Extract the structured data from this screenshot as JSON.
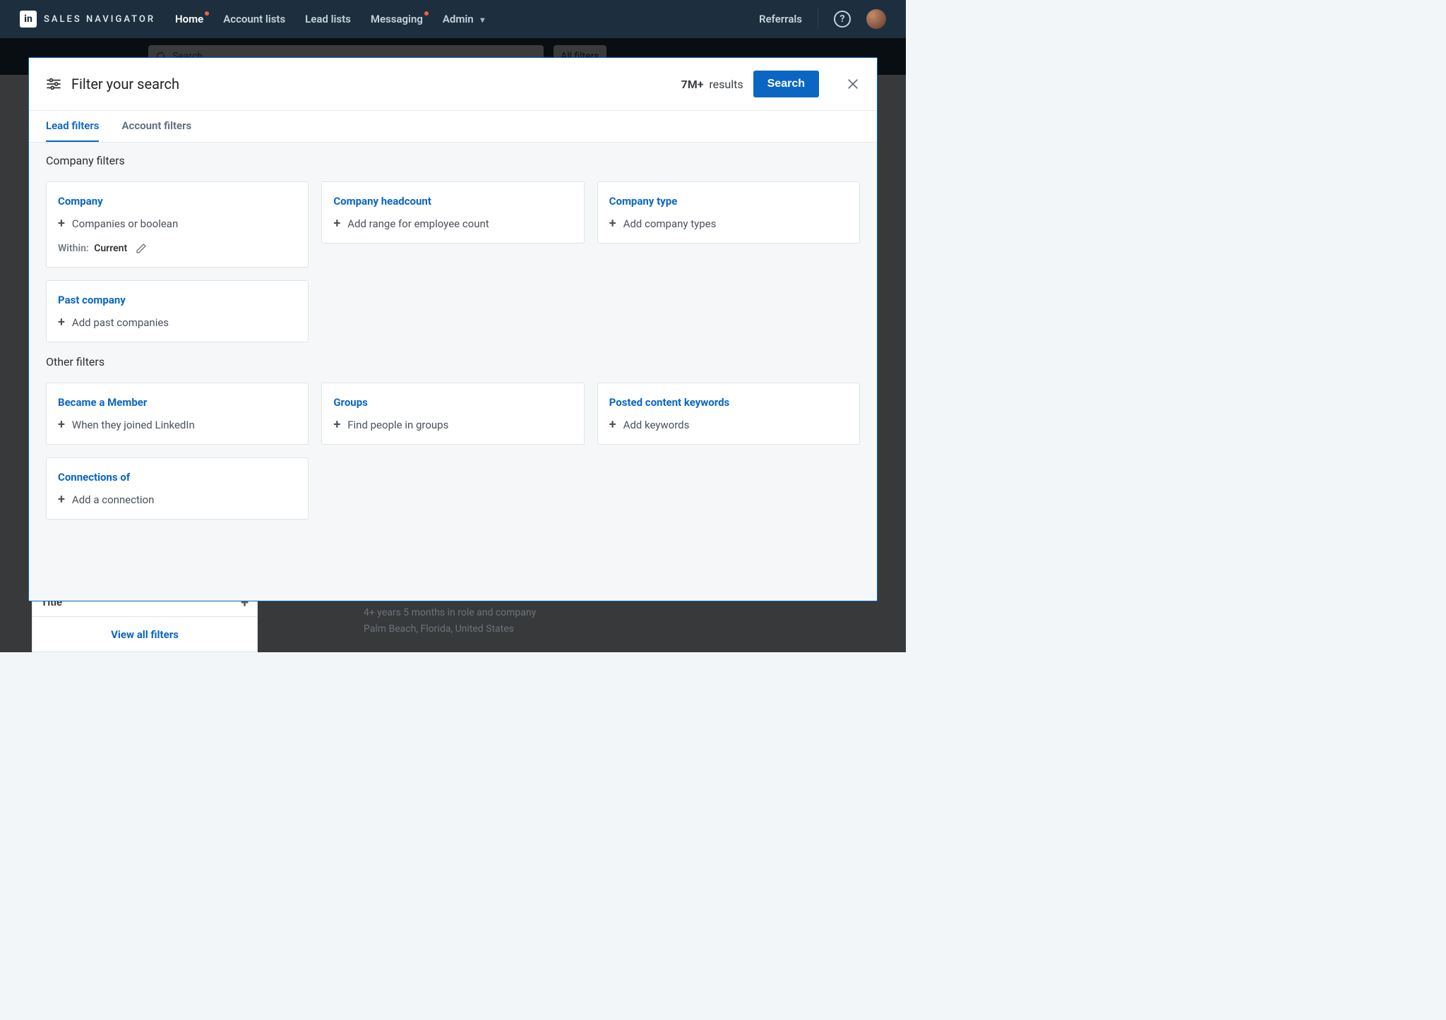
{
  "nav": {
    "logo_mark": "in",
    "logo_text": "SALES NAVIGATOR",
    "items": [
      {
        "label": "Home",
        "dot": true
      },
      {
        "label": "Account lists",
        "dot": false
      },
      {
        "label": "Lead lists",
        "dot": false
      },
      {
        "label": "Messaging",
        "dot": true
      },
      {
        "label": "Admin",
        "dot": false,
        "caret": true
      }
    ],
    "referrals": "Referrals"
  },
  "searchrow": {
    "placeholder": "Search…",
    "all_filters": "All filters"
  },
  "modal": {
    "title": "Filter your search",
    "results_count": "7M+",
    "results_word": "results",
    "search_btn": "Search",
    "tabs": [
      {
        "label": "Lead filters",
        "active": true
      },
      {
        "label": "Account filters",
        "active": false
      }
    ],
    "sections": [
      {
        "title": "Company filters",
        "cards": [
          {
            "id": "company",
            "title": "Company",
            "action": "Companies or boolean",
            "within_label": "Within:",
            "within_value": "Current"
          },
          {
            "id": "company-headcount",
            "title": "Company headcount",
            "action": "Add range for employee count"
          },
          {
            "id": "company-type",
            "title": "Company type",
            "action": "Add company types"
          },
          {
            "id": "past-company",
            "title": "Past company",
            "action": "Add past companies"
          }
        ]
      },
      {
        "title": "Other filters",
        "cards": [
          {
            "id": "became-member",
            "title": "Became a Member",
            "action": "When they joined LinkedIn"
          },
          {
            "id": "groups",
            "title": "Groups",
            "action": "Find people in groups"
          },
          {
            "id": "posted-content",
            "title": "Posted content keywords",
            "action": "Add keywords"
          },
          {
            "id": "connections-of",
            "title": "Connections of",
            "action": "Add a connection"
          }
        ]
      }
    ]
  },
  "behind": {
    "title_label": "Title",
    "view_all": "View all filters",
    "tenure": "4+ years 5 months in role and company",
    "location": "Palm Beach, Florida, United States"
  }
}
